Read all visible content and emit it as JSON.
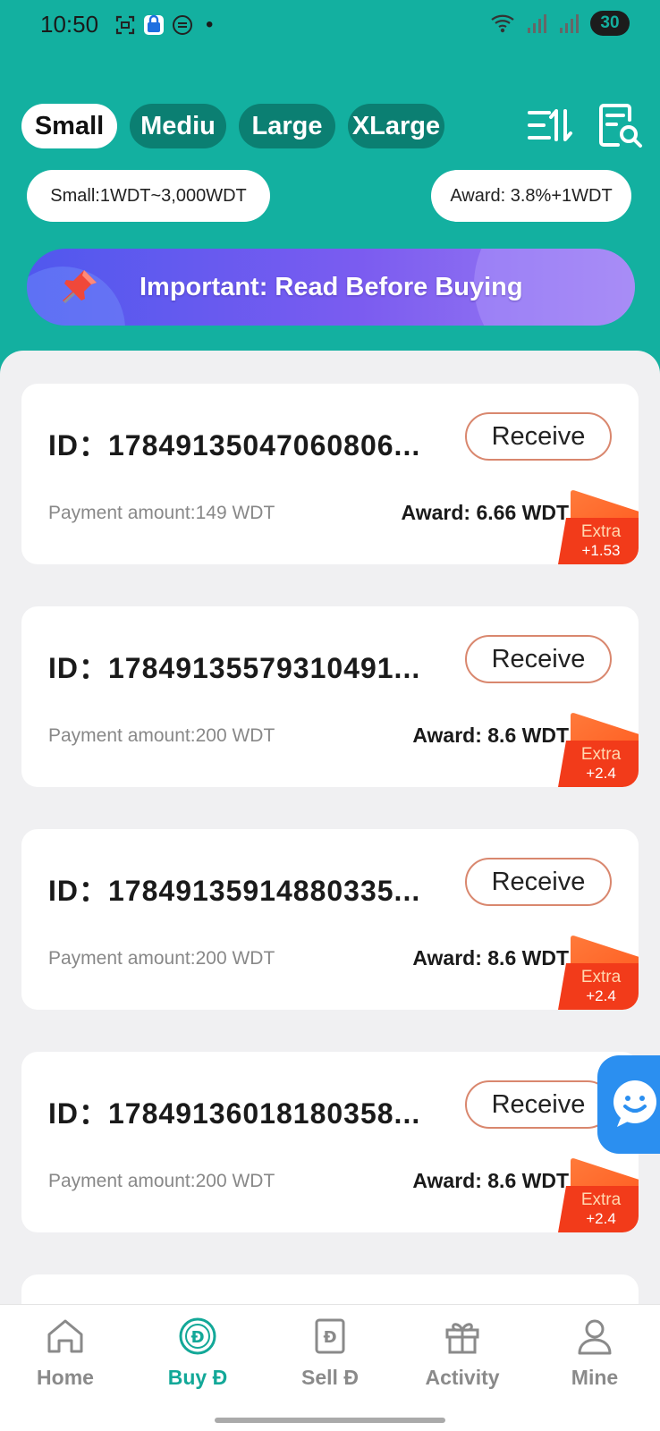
{
  "status_bar": {
    "time": "10:50",
    "battery": "30",
    "icons": [
      "screenshot-icon",
      "lock-app-icon",
      "sync-icon",
      "dot-icon",
      "wifi-icon",
      "signal-icon",
      "signal-icon"
    ]
  },
  "size_tabs": [
    {
      "label": "Small",
      "active": true
    },
    {
      "label": "Mediu",
      "active": false
    },
    {
      "label": "Large",
      "active": false
    },
    {
      "label": "XLarge",
      "active": false
    }
  ],
  "header_actions": {
    "sort_icon": "sort-icon",
    "search_icon": "document-search-icon"
  },
  "range_info": "Small:1WDT~3,000WDT",
  "award_info": "Award: 3.8%+1WDT",
  "banner": {
    "text": "Important: Read Before Buying",
    "icon": "pin-icon"
  },
  "colors": {
    "primary": "#13b0a0",
    "tab_inactive": "#0b7f72",
    "extra": "#f23b1a",
    "receive_border": "#d9876e",
    "fab": "#2b8ff0"
  },
  "orders": [
    {
      "id": "ID：17849135047060806...",
      "receive_label": "Receive",
      "payment": "Payment amount:149 WDT",
      "award": "Award: 6.66 WDT",
      "extra_label": "Extra",
      "extra_value": "+1.53"
    },
    {
      "id": "ID：17849135579310491...",
      "receive_label": "Receive",
      "payment": "Payment amount:200 WDT",
      "award": "Award: 8.6 WDT",
      "extra_label": "Extra",
      "extra_value": "+2.4"
    },
    {
      "id": "ID：17849135914880335...",
      "receive_label": "Receive",
      "payment": "Payment amount:200 WDT",
      "award": "Award: 8.6 WDT",
      "extra_label": "Extra",
      "extra_value": "+2.4"
    },
    {
      "id": "ID：17849136018180358...",
      "receive_label": "Receive",
      "payment": "Payment amount:200 WDT",
      "award": "Award: 8.6 WDT",
      "extra_label": "Extra",
      "extra_value": "+2.4"
    }
  ],
  "chat_fab_icon": "chat-smile-icon",
  "bottom_nav": [
    {
      "label": "Home",
      "icon": "home-icon",
      "active": false
    },
    {
      "label": "Buy Đ",
      "icon": "buy-coin-icon",
      "active": true
    },
    {
      "label": "Sell Đ",
      "icon": "sell-doc-icon",
      "active": false
    },
    {
      "label": "Activity",
      "icon": "gift-icon",
      "active": false
    },
    {
      "label": "Mine",
      "icon": "user-icon",
      "active": false
    }
  ]
}
